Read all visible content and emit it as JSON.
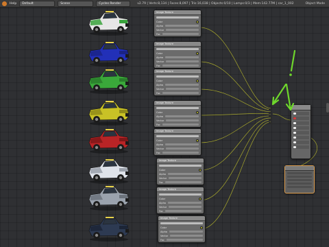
{
  "topbar": {
    "help_menu": "Help",
    "layout_field": "Default",
    "scene_field": "Scene",
    "render_engine": "Cycles Render",
    "stats": "v2.79 | Verts:8,134 | Faces:8,097 | Tris:16,038 | Objects:0/10 | Lamps:0/3 | Mem:142.77M | car_1_002",
    "mode": "Object Mode"
  },
  "trucks": [
    {
      "label": "truck-white-green",
      "body": "#e6e6e6",
      "accent": "#39a33c"
    },
    {
      "label": "truck-blue",
      "body": "#2230b8",
      "accent": "#1a2386"
    },
    {
      "label": "truck-green",
      "body": "#3aa83a",
      "accent": "#2a7d2b"
    },
    {
      "label": "truck-yellow",
      "body": "#c9c226",
      "accent": "#918b19"
    },
    {
      "label": "truck-red",
      "body": "#b82426",
      "accent": "#7e1819"
    },
    {
      "label": "truck-white",
      "body": "#dfe3ea",
      "accent": "#9aa0aa"
    },
    {
      "label": "truck-silver",
      "body": "#9aa2ad",
      "accent": "#6c737c"
    },
    {
      "label": "truck-dark-blue",
      "body": "#2d3a52",
      "accent": "#1c2536"
    }
  ],
  "nodes": [
    {
      "title": "Image Texture",
      "rows": [
        "Color",
        "Alpha",
        "Vector",
        "Fac"
      ]
    },
    {
      "title": "Image Texture",
      "rows": [
        "Color",
        "Alpha",
        "Vector",
        "Fac"
      ]
    },
    {
      "title": "Image Texture",
      "rows": [
        "Color",
        "Alpha",
        "Vector",
        "Fac"
      ]
    },
    {
      "title": "Image Texture",
      "rows": [
        "Color",
        "Alpha",
        "Vector",
        "Fac"
      ]
    },
    {
      "title": "Image Texture",
      "rows": [
        "Color",
        "Alpha",
        "Vector",
        "Fac"
      ]
    },
    {
      "title": "Image Texture",
      "rows": [
        "Color",
        "Alpha",
        "Vector",
        "Fac"
      ]
    },
    {
      "title": "Image Texture",
      "rows": [
        "Color",
        "Alpha",
        "Vector",
        "Fac"
      ]
    },
    {
      "title": "Image Texture",
      "rows": [
        "Color",
        "Alpha",
        "Vector",
        "Fac"
      ]
    }
  ],
  "annotation": {
    "mark": "!",
    "color": "#6fd82c"
  }
}
